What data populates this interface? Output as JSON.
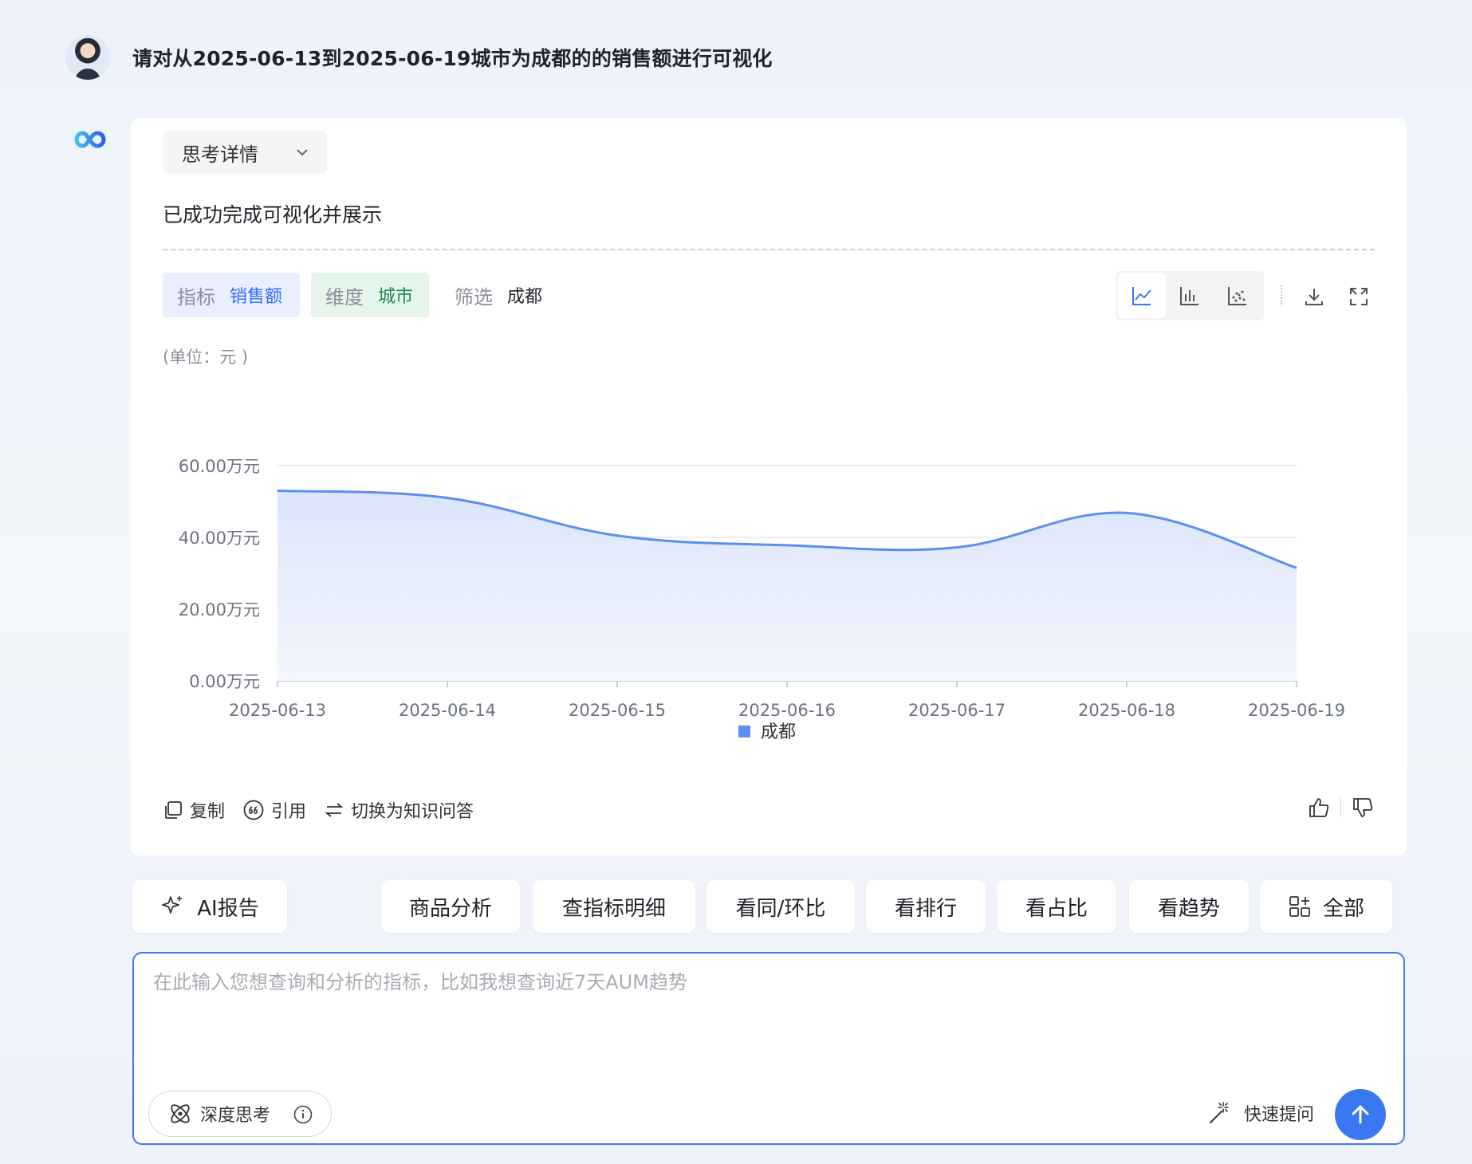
{
  "conversation": {
    "user_question": "请对从2025-06-13到2025-06-19城市为成都的的销售额进行可视化"
  },
  "answer": {
    "think_toggle_label": "思考详情",
    "status_text": "已成功完成可视化并展示",
    "tags": {
      "metric_key": "指标",
      "metric_value": "销售额",
      "dimension_key": "维度",
      "dimension_value": "城市",
      "filter_key": "筛选",
      "filter_value": "成都"
    },
    "chart_type_buttons": [
      "line-chart-icon",
      "bar-chart-icon",
      "scatter-chart-icon"
    ],
    "active_chart_type": "line",
    "unit_label": "(单位：元 )",
    "actions": {
      "copy": "复制",
      "cite": "引用",
      "switch": "切换为知识问答"
    }
  },
  "chart_data": {
    "type": "area",
    "x": [
      "2025-06-13",
      "2025-06-14",
      "2025-06-15",
      "2025-06-16",
      "2025-06-17",
      "2025-06-18",
      "2025-06-19"
    ],
    "series": [
      {
        "name": "成都",
        "values": [
          53.0,
          51.0,
          40.5,
          37.8,
          37.2,
          46.8,
          31.5
        ],
        "color": "#5b8ff0"
      }
    ],
    "y_ticks": [
      "0.00万元",
      "20.00万元",
      "40.00万元",
      "60.00万元"
    ],
    "ylim": [
      0,
      60
    ],
    "grid": true,
    "smooth": true,
    "legend": "bottom-center"
  },
  "quick_chips": {
    "ai_report": "AI报告",
    "items": [
      "商品分析",
      "查指标明细",
      "看同/环比",
      "看排行",
      "看占比",
      "看趋势"
    ],
    "all": "全部"
  },
  "input": {
    "placeholder": "在此输入您想查询和分析的指标，比如我想查询近7天AUM趋势",
    "deep_think": "深度思考",
    "quick_ask": "快速提问"
  },
  "colors": {
    "accent": "#3a78f2",
    "metric_tag_bg": "#e9efff",
    "dimension_tag_bg": "#e6f5ec"
  }
}
